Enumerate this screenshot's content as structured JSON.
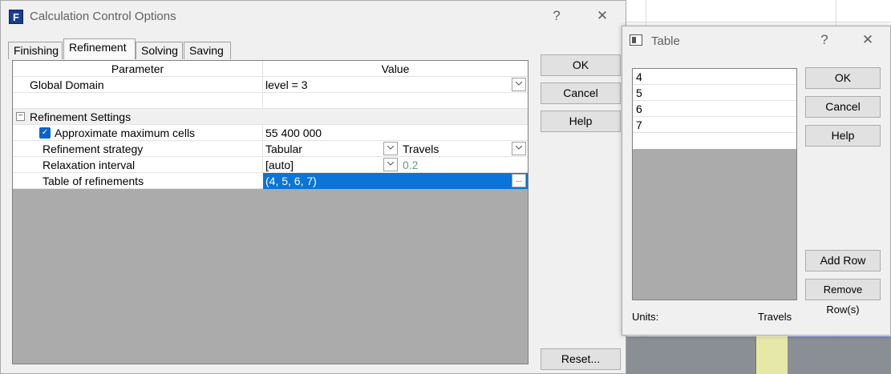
{
  "main_dialog": {
    "title": "Calculation Control Options",
    "help_glyph": "?",
    "close_glyph": "✕",
    "tabs": [
      "Finishing",
      "Refinement",
      "Solving",
      "Saving"
    ],
    "grid": {
      "headers": {
        "parameter": "Parameter",
        "value": "Value"
      },
      "rows": {
        "global_domain": {
          "label": "Global Domain",
          "value": "level = 3"
        },
        "refinement_settings": {
          "label": "Refinement Settings",
          "collapse_glyph": "−"
        },
        "approx_cells": {
          "label": "Approximate maximum cells",
          "value": "55 400 000",
          "checked": true
        },
        "strategy": {
          "label": "Refinement strategy",
          "value": "Tabular",
          "unit": "Travels"
        },
        "relaxation": {
          "label": "Relaxation interval",
          "value": "[auto]",
          "extra": "0.2"
        },
        "table": {
          "label": "Table of refinements",
          "value": "(4, 5, 6, 7)",
          "ellipsis": "..."
        }
      }
    },
    "buttons": {
      "ok": "OK",
      "cancel": "Cancel",
      "help": "Help",
      "reset": "Reset..."
    }
  },
  "table_dialog": {
    "title": "Table",
    "help_glyph": "?",
    "close_glyph": "✕",
    "rows": [
      "4",
      "5",
      "6",
      "7"
    ],
    "units_label": "Units:",
    "units_value": "Travels",
    "buttons": {
      "ok": "OK",
      "cancel": "Cancel",
      "help": "Help",
      "add_row": "Add Row",
      "remove_rows": "Remove Row(s)"
    }
  },
  "colors": {
    "selection": "#0a74d8",
    "checkbox": "#0a64c8",
    "grid_empty": "#ababab"
  }
}
